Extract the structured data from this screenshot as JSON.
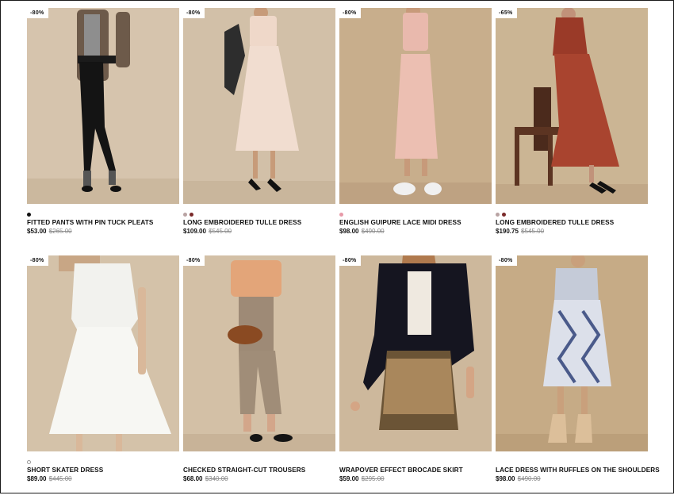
{
  "products": [
    {
      "discount": "-80%",
      "title": "FITTED PANTS WITH PIN TUCK PLEATS",
      "price": "$53.00",
      "old_price": "$265.00",
      "swatches": [
        "#111111"
      ],
      "photo_bg": "#d6c4ad",
      "image": "model-in-plaid-blazer-and-black-pants-image"
    },
    {
      "discount": "-80%",
      "title": "LONG EMBROIDERED TULLE DRESS",
      "price": "$109.00",
      "old_price": "$545.00",
      "swatches": [
        "#b9a3a3",
        "#7a2a2a"
      ],
      "photo_bg": "#d2c0a8",
      "image": "model-in-pale-pink-tulle-dress-image"
    },
    {
      "discount": "-80%",
      "title": "ENGLISH GUIPURE LACE MIDI DRESS",
      "price": "$98.00",
      "old_price": "$490.00",
      "swatches": [
        "#e79aa8"
      ],
      "photo_bg": "#c8ae8c",
      "image": "model-in-pink-lace-midi-dress-image"
    },
    {
      "discount": "-65%",
      "title": "LONG EMBROIDERED TULLE DRESS",
      "price": "$190.75",
      "old_price": "$545.00",
      "swatches": [
        "#b9a3a3",
        "#7a2a2a"
      ],
      "photo_bg": "#cbb594",
      "image": "model-in-rust-tulle-dress-with-chair-image"
    },
    {
      "discount": "-80%",
      "title": "SHORT SKATER DRESS",
      "price": "$89.00",
      "old_price": "$445.00",
      "swatches": [
        "hollow"
      ],
      "photo_bg": "#d4c2a9",
      "image": "model-in-white-skater-dress-image"
    },
    {
      "discount": "-80%",
      "title": "CHECKED STRAIGHT-CUT TROUSERS",
      "price": "$68.00",
      "old_price": "$340.00",
      "swatches": [],
      "photo_bg": "#d3c0a6",
      "image": "model-in-checked-trousers-image"
    },
    {
      "discount": "-80%",
      "title": "WRAPOVER EFFECT BROCADE SKIRT",
      "price": "$59.00",
      "old_price": "$295.00",
      "swatches": [],
      "photo_bg": "#cdb89c",
      "image": "model-in-black-jacket-and-brocade-skirt-image"
    },
    {
      "discount": "-80%",
      "title": "LACE DRESS WITH RUFFLES ON THE SHOULDERS",
      "price": "$98.00",
      "old_price": "$490.00",
      "swatches": [],
      "photo_bg": "#c6ab86",
      "image": "model-in-blue-white-print-dress-image"
    }
  ]
}
